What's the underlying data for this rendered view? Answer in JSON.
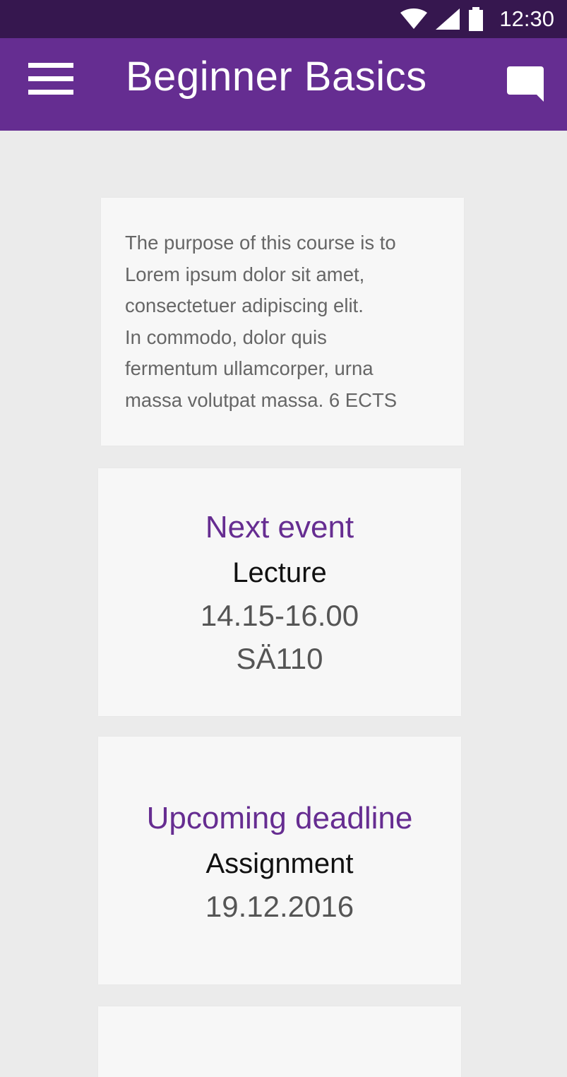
{
  "status_bar": {
    "time": "12:30",
    "icons": [
      "wifi-icon",
      "cell-signal-icon",
      "battery-icon"
    ]
  },
  "app_bar": {
    "title": "Beginner Basics",
    "menu_icon": "hamburger-menu-icon",
    "chat_icon": "chat-bubble-icon"
  },
  "colors": {
    "status_bar": "#36174f",
    "app_bar": "#652d91",
    "accent": "#662d91",
    "background": "#ebebeb",
    "card": "#f7f7f7"
  },
  "description": {
    "text": "The purpose of this course is to\nLorem ipsum dolor sit amet,\nconsectetuer adipiscing elit.\nIn commodo, dolor quis\nfermentum ullamcorper, urna\nmassa volutpat massa. 6 ECTS"
  },
  "next_event": {
    "heading": "Next event",
    "type": "Lecture",
    "time": "14.15-16.00",
    "room": "SÄ110"
  },
  "upcoming_deadline": {
    "heading": "Upcoming deadline",
    "type": "Assignment",
    "date": "19.12.2016"
  }
}
